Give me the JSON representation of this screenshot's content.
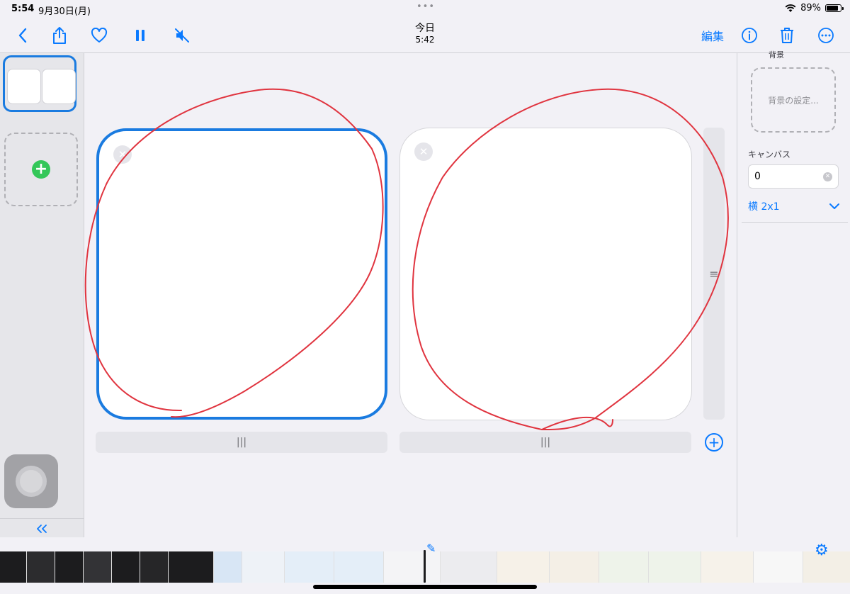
{
  "status": {
    "time": "5:54",
    "date": "9月30日(月)",
    "dots": "•••",
    "battery": "89%"
  },
  "toolbar": {
    "title": "今日",
    "subtitle": "5:42",
    "edit_label": "編集"
  },
  "inspector": {
    "background_label": "背景",
    "background_placeholder": "背景の設定...",
    "canvas_label": "キャンバス",
    "canvas_value": "0",
    "layout_value": "横 2x1"
  },
  "handles": {
    "horizontal": "|||",
    "vertical": "≡"
  },
  "icons": {
    "back": "chevron-left-icon",
    "share": "share-icon",
    "favorite": "heart-icon",
    "pause": "pause-icon",
    "mute": "speaker-muted-icon",
    "info": "info-icon",
    "trash": "trash-icon",
    "more": "ellipsis-circle-icon",
    "collapse": "double-chevron-left-icon",
    "add": "plus-icon",
    "close": "close-icon",
    "chevron-down": "chevron-down-icon"
  },
  "colors": {
    "accent": "#0a7aff",
    "selection": "#1a7be0",
    "annotation": "#e0343f",
    "add_green": "#34c759"
  }
}
